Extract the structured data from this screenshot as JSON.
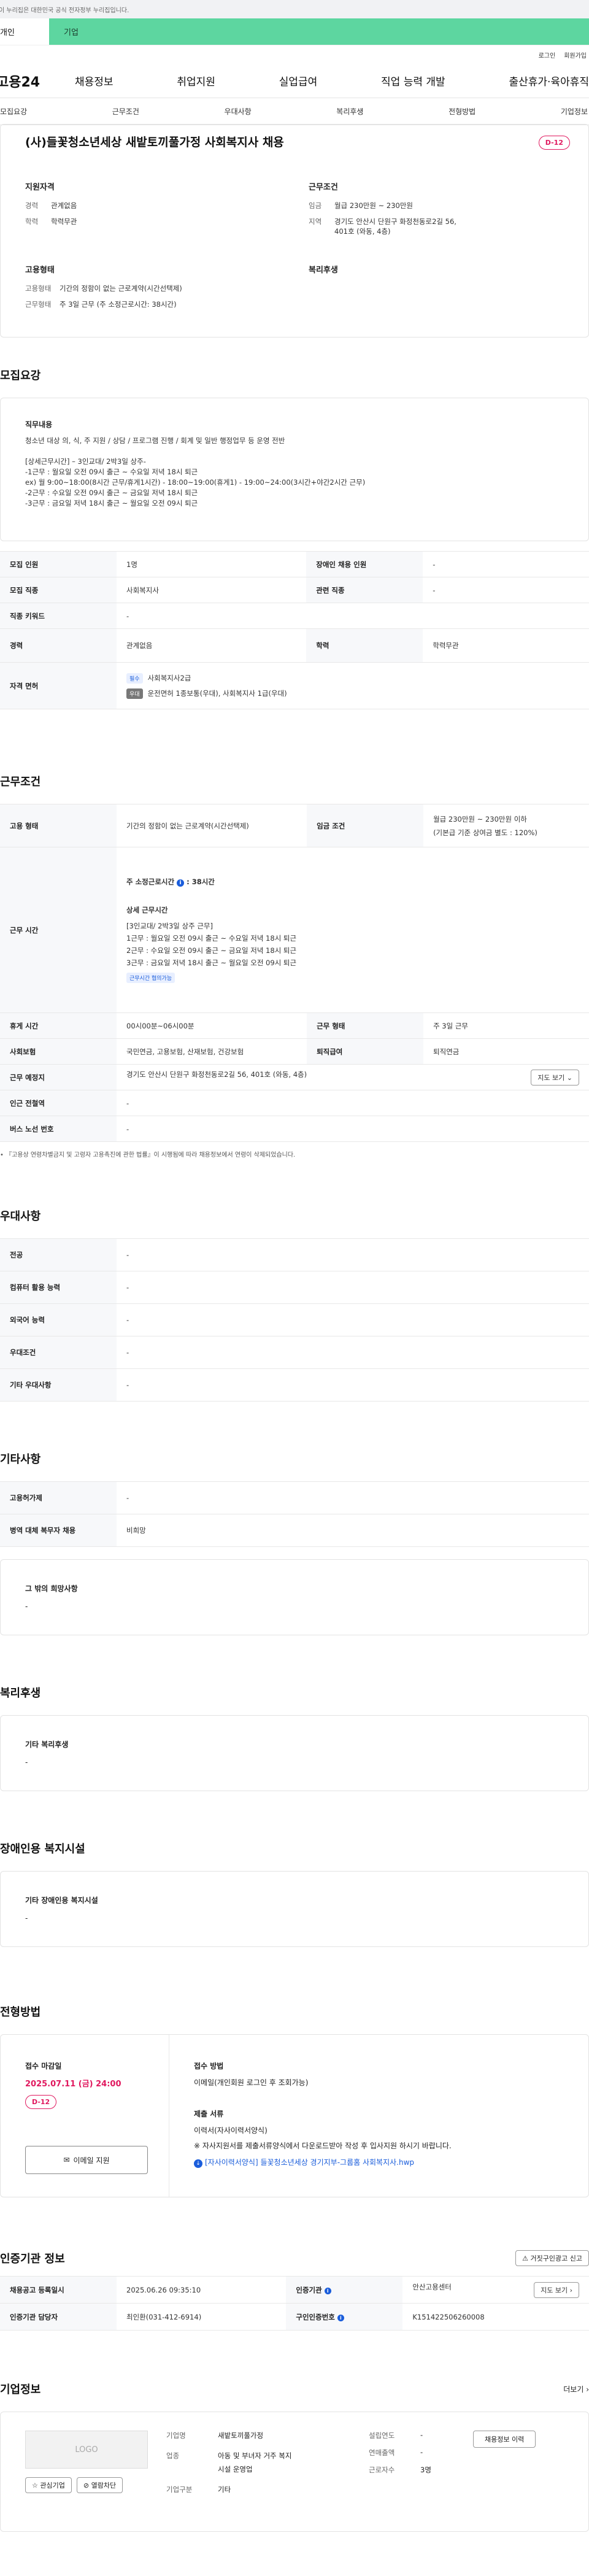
{
  "gov_banner": "이 누리집은 대한민국 공식 전자정부 누리집입니다.",
  "top_tabs": [
    "개인",
    "기업"
  ],
  "util": [
    "로그인",
    "회원가입"
  ],
  "logo": "고용24",
  "gnb": [
    "채용정보",
    "취업지원",
    "실업급여",
    "직업 능력 개발",
    "출산휴가·육아휴직"
  ],
  "lnb": [
    "모집요강",
    "근무조건",
    "우대사항",
    "복리후생",
    "전형방법",
    "기업정보"
  ],
  "job": {
    "title": "(사)들꽃청소년세상 새밭토끼풀가정 사회복지사 채용",
    "dday": "D-12",
    "sum": {
      "qual_h": "지원자격",
      "career_k": "경력",
      "career_v": "관계없음",
      "edu_k": "학력",
      "edu_v": "학력무관",
      "cond_h": "근무조건",
      "wage_k": "임금",
      "wage_v": "월급 230만원 ~ 230만원",
      "loc_k": "지역",
      "loc_v": "경기도 안산시 단원구 화정천동로2길 56, 401호 (와동, 4층)",
      "emp_h": "고용형태",
      "type_k": "고용형태",
      "type_v": "기간의 정함이 없는 근로계약(시간선택제)",
      "hours_k": "근무형태",
      "hours_v": "주 3일 근무 (주 소정근로시간: 38시간)",
      "welfare_h": "복리후생"
    }
  },
  "recruit": {
    "title": "모집요강",
    "duty_h": "직무내용",
    "duty_lines": [
      "청소년 대상 의, 식, 주 지원 / 상담 / 프로그램 진행 / 회계 및 일반 행정업무 등 운영 전반",
      "",
      "[상세근무시간] – 3인교대/ 2박3일 상주-",
      "-1근무 : 월요일 오전 09시 출근 ~ 수요일 저녁 18시 퇴근",
      "ex) 월 9:00~18:00(8시간 근무/휴게1시간) - 18:00~19:00(휴게1) - 19:00~24:00(3시간+야간2시간 근무)",
      "-2근무 : 수요일 오전 09시 출근 ~ 금요일 저녁 18시 퇴근",
      "-3근무 : 금요일 저녁 18시 출근 ~ 월요일 오전 09시 퇴근"
    ],
    "rows": [
      [
        "모집 인원",
        "1명",
        "장애인 채용 인원",
        "-"
      ],
      [
        "모집 직종",
        "사회복지사",
        "관련 직종",
        "-"
      ],
      [
        "직종 키워드",
        "-"
      ],
      [
        "경력",
        "관계없음",
        "학력",
        "학력무관"
      ]
    ],
    "lic_k": "자격 면허",
    "lic_tag1": "필수",
    "lic_v1": "사회복지사2급",
    "lic_tag2": "우대",
    "lic_v2": "운전면허 1종보통(우대), 사회복지사 1급(우대)"
  },
  "work": {
    "title": "근무조건",
    "r1": [
      "고용 형태",
      "기간의 정함이 없는 근로계약(시간선택제)",
      "임금 조건",
      "월급 230만원 ~ 230만원 이하",
      "(기본급 기준 상여금 별도 : 120%)"
    ],
    "time_k": "근무 시간",
    "time_h": "주 소정근로시간",
    "time_v": "38시간",
    "detail_h": "상세 근무시간",
    "detail_lines": [
      "[3인교대/ 2박3일 상주 근무]",
      "1근무 : 월요일 오전 09시 출근 ~ 수요일 저녁 18시 퇴근",
      "2근무 : 수요일 오전 09시 출근 ~ 금요일 저녁 18시 퇴근",
      "3근무 : 금요일 저녁 18시 출근 ~ 월요일 오전 09시 퇴근"
    ],
    "time_tag": "근무시간 협의가능",
    "r3": [
      "휴게 시간",
      "00시00분~06시00분",
      "근무 형태",
      "주 3일 근무"
    ],
    "r4": [
      "사회보험",
      "국민연금, 고용보험, 산재보험, 건강보험",
      "퇴직급여",
      "퇴직연금"
    ],
    "r5": [
      "근무 예정지",
      "경기도 안산시 단원구 화정천동로2길 56, 401호 (와동, 4층)"
    ],
    "map_btn": "지도 보기",
    "r6": [
      "인근 전철역",
      "-"
    ],
    "r7": [
      "버스 노선 번호",
      "-"
    ],
    "note": "• 『고용상 연령차별금지 및 고령자 고용촉진에 관한 법률』이 시행됨에 따라 채용정보에서 연령이 삭제되었습니다."
  },
  "pref": {
    "title": "우대사항",
    "rows": [
      [
        "전공",
        "-"
      ],
      [
        "컴퓨터 활용 능력",
        "-"
      ],
      [
        "외국어 능력",
        "-"
      ],
      [
        "우대조건",
        "-"
      ],
      [
        "기타 우대사항",
        "-"
      ]
    ]
  },
  "etc": {
    "title": "기타사항",
    "rows": [
      [
        "고용허가제",
        "-"
      ],
      [
        "병역 대체 복무자 채용",
        "비희망"
      ]
    ],
    "other_h": "그 밖의 희망사항",
    "other_v": "-"
  },
  "welfare": {
    "title": "복리후생",
    "h": "기타 복리후생",
    "v": "-"
  },
  "disab": {
    "title": "장애인용 복지시설",
    "h": "기타 장애인용 복지시설",
    "v": "-"
  },
  "process": {
    "title": "전형방법",
    "deadline_h": "접수 마감일",
    "deadline_v": "2025.07.11 (금) 24:00",
    "dday": "D-12",
    "email_btn": "이메일 지원",
    "method_h": "접수 방법",
    "method_v": "이메일(개인회원 로그인 후 조회가능)",
    "docs_h": "제출 서류",
    "docs_v1": "이력서(자사이력서양식)",
    "docs_v2": "※ 자사지원서를 제출서류양식에서 다운로드받아 작성 후 입사지원 하시기 바랍니다.",
    "file": "[자사이력서양식] 들꽃청소년세상 경기지부-그룹홈 사회복지사.hwp"
  },
  "agency": {
    "title": "인증기관 정보",
    "report_btn": "거짓구인광고 신고",
    "r1": [
      "채용공고 등록일시",
      "2025.06.26 09:35:10",
      "인증기관",
      "안산고용센터"
    ],
    "map_btn": "지도 보기",
    "r2": [
      "인증기관 담당자",
      "최인환(031-412-6914)",
      "구인인증번호",
      "K151422506260008"
    ]
  },
  "company": {
    "title": "기업정보",
    "more": "더보기",
    "logo": "LOGO",
    "fav": "관심기업",
    "block": "열람차단",
    "name_k": "기업명",
    "name_v": "새밭토끼풀가정",
    "ind_k": "업종",
    "ind_v": "아동 및 부녀자 거주 복지시설 운영업",
    "founded_k": "설립연도",
    "founded_v": "-",
    "sales_k": "연매출액",
    "sales_v": "-",
    "emp_k": "근로자수",
    "emp_v": "3명",
    "type_k": "기업구분",
    "type_v": "기타",
    "jobs_btn": "채용정보 이력"
  }
}
